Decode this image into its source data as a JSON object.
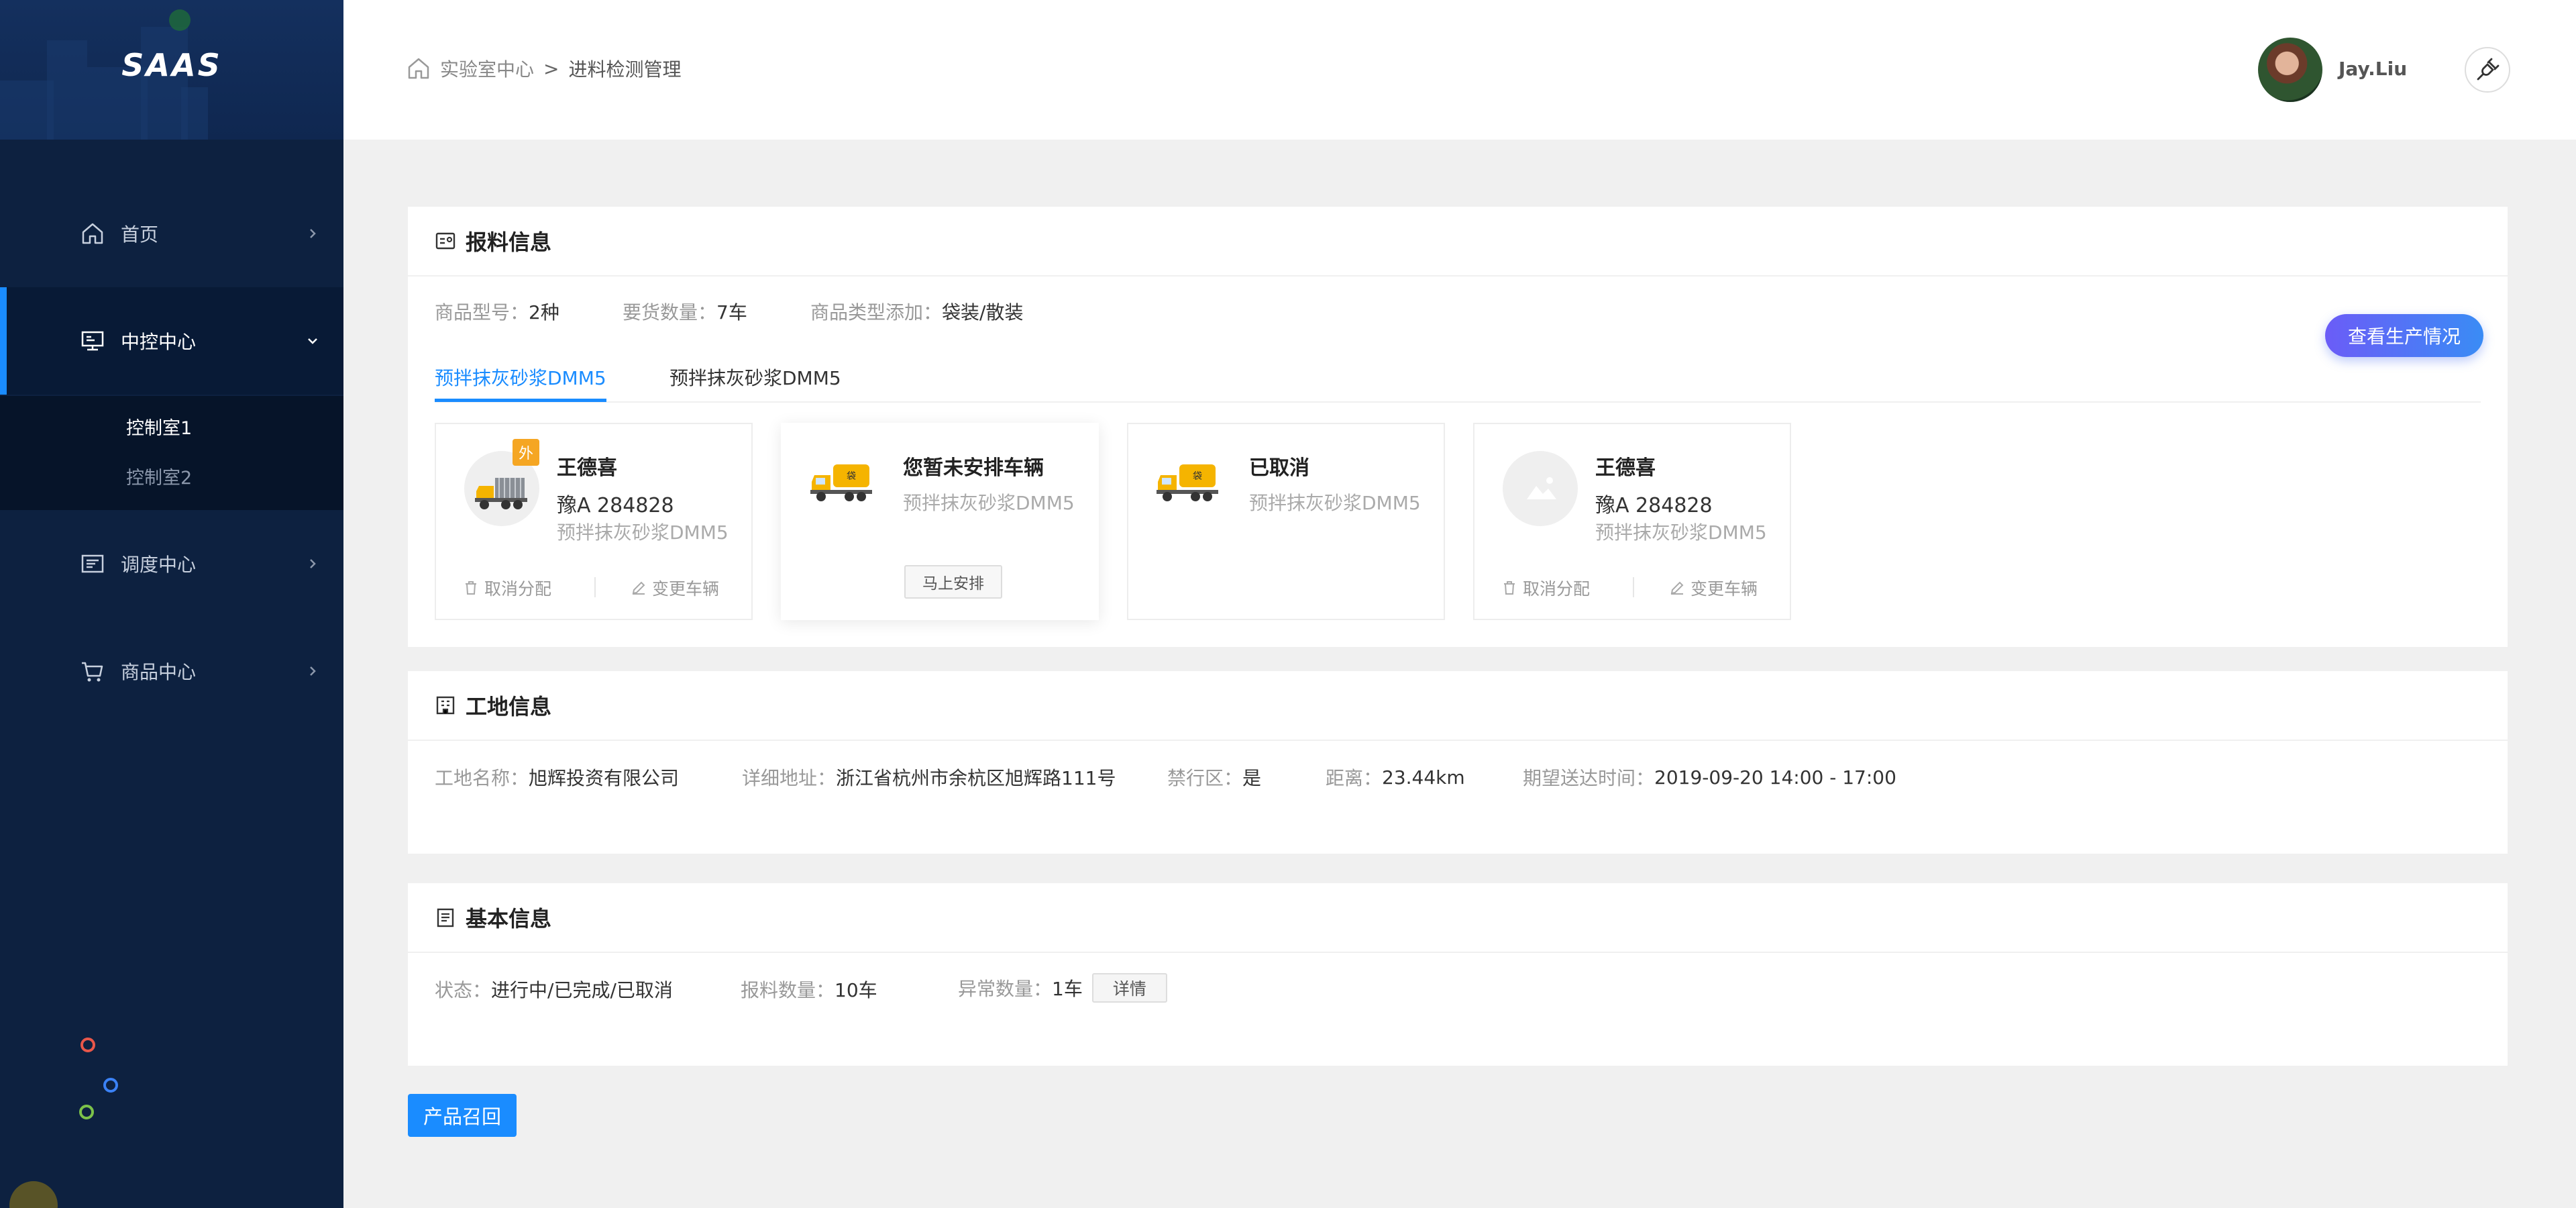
{
  "app": {
    "logo": "SAAS"
  },
  "sidebar": {
    "items": [
      {
        "label": "首页",
        "icon": "home-icon"
      },
      {
        "label": "中控中心",
        "icon": "monitor-icon",
        "active": true
      },
      {
        "label": "调度中心",
        "icon": "schedule-icon"
      },
      {
        "label": "商品中心",
        "icon": "cart-icon"
      }
    ],
    "submenu": [
      "控制室1",
      "控制室2"
    ],
    "dot_colors": [
      "#e8574a",
      "#3b82f6",
      "#7cc24a"
    ]
  },
  "header": {
    "breadcrumb": [
      "实验室中心",
      "进料检测管理"
    ],
    "separator": ">",
    "user_name": "Jay.Liu"
  },
  "report": {
    "title": "报料信息",
    "fields": [
      {
        "key": "商品型号：",
        "value": "2种"
      },
      {
        "key": "要货数量：",
        "value": "7车"
      },
      {
        "key": "商品类型添加：",
        "value": "袋装/散装"
      }
    ],
    "production_button": "查看生产情况",
    "tabs": [
      "预拌抹灰砂浆DMM5",
      "预拌抹灰砂浆DMM5"
    ],
    "vehicles": [
      {
        "name": "王德喜",
        "plate": "豫A  284828",
        "product": "预拌抹灰砂浆DMM5",
        "badge": "外",
        "cancel": "取消分配",
        "change": "变更车辆"
      },
      {
        "name": "您暂未安排车辆",
        "product": "预拌抹灰砂浆DMM5",
        "action": "马上安排"
      },
      {
        "name": "已取消",
        "product": "预拌抹灰砂浆DMM5"
      },
      {
        "name": "王德喜",
        "plate": "豫A  284828",
        "product": "预拌抹灰砂浆DMM5",
        "cancel": "取消分配",
        "change": "变更车辆"
      }
    ]
  },
  "site": {
    "title": "工地信息",
    "fields": [
      {
        "key": "工地名称：",
        "value": "旭辉投资有限公司"
      },
      {
        "key": "详细地址：",
        "value": "浙江省杭州市余杭区旭辉路111号"
      },
      {
        "key": "禁行区：",
        "value": "是"
      },
      {
        "key": "距离：",
        "value": "23.44km"
      },
      {
        "key": "期望送达时间：",
        "value": "2019-09-20  14:00 - 17:00"
      }
    ]
  },
  "basic": {
    "title": "基本信息",
    "fields": [
      {
        "key": "状态：",
        "value": "进行中/已完成/已取消"
      },
      {
        "key": "报料数量：",
        "value": "10车"
      },
      {
        "key": "异常数量：",
        "value": "1车"
      }
    ],
    "detail_button": "详情"
  },
  "recall_button": "产品召回",
  "colors": {
    "accent": "#1a8cff",
    "sidebar_bg": "#0d2140",
    "badge": "#f5a623"
  }
}
